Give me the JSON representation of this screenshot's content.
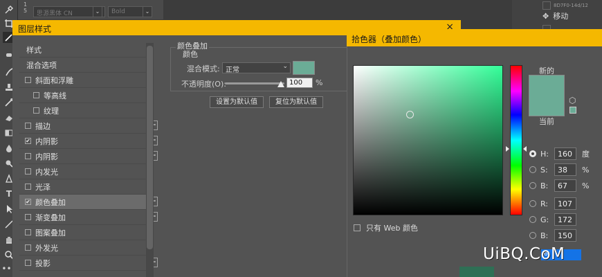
{
  "options_bar": {
    "digits": "1 5",
    "font_family": "思源黑体 CN",
    "font_style": "Bold"
  },
  "right_panel": {
    "item_label": "移动",
    "item_small": "8D7F0-14d/12"
  },
  "layer_style": {
    "title": "图层样式",
    "close": "×",
    "list": [
      {
        "label": "样式",
        "checkbox": false,
        "checked": false,
        "plus": false,
        "indent": false,
        "active": false
      },
      {
        "label": "混合选项",
        "checkbox": false,
        "checked": false,
        "plus": false,
        "indent": false,
        "active": false
      },
      {
        "label": "斜面和浮雕",
        "checkbox": true,
        "checked": false,
        "plus": false,
        "indent": false,
        "active": false
      },
      {
        "label": "等高线",
        "checkbox": true,
        "checked": false,
        "plus": false,
        "indent": true,
        "active": false
      },
      {
        "label": "纹理",
        "checkbox": true,
        "checked": false,
        "plus": false,
        "indent": true,
        "active": false
      },
      {
        "label": "描边",
        "checkbox": true,
        "checked": false,
        "plus": true,
        "indent": false,
        "active": false
      },
      {
        "label": "内阴影",
        "checkbox": true,
        "checked": true,
        "plus": true,
        "indent": false,
        "active": false
      },
      {
        "label": "内阴影",
        "checkbox": true,
        "checked": false,
        "plus": true,
        "indent": false,
        "active": false
      },
      {
        "label": "内发光",
        "checkbox": true,
        "checked": false,
        "plus": false,
        "indent": false,
        "active": false
      },
      {
        "label": "光泽",
        "checkbox": true,
        "checked": false,
        "plus": false,
        "indent": false,
        "active": false
      },
      {
        "label": "颜色叠加",
        "checkbox": true,
        "checked": true,
        "plus": true,
        "indent": false,
        "active": true
      },
      {
        "label": "渐变叠加",
        "checkbox": true,
        "checked": false,
        "plus": true,
        "indent": false,
        "active": false
      },
      {
        "label": "图案叠加",
        "checkbox": true,
        "checked": false,
        "plus": false,
        "indent": false,
        "active": false
      },
      {
        "label": "外发光",
        "checkbox": true,
        "checked": false,
        "plus": false,
        "indent": false,
        "active": false
      },
      {
        "label": "投影",
        "checkbox": true,
        "checked": false,
        "plus": true,
        "indent": false,
        "active": false
      }
    ],
    "color_overlay": {
      "legend": "颜色叠加",
      "sub_legend": "颜色",
      "blend_mode_label": "混合模式:",
      "blend_mode": "正常",
      "opacity_label": "不透明度(O):",
      "opacity": "100",
      "opacity_fraction": 1.0,
      "opacity_unit": "%",
      "swatch_color": "#6bac96",
      "set_default": "设置为默认值",
      "reset_default": "复位为默认值"
    }
  },
  "color_picker": {
    "title": "拾色器（叠加颜色）",
    "new_label": "新的",
    "current_label": "当前",
    "new_color": "#6bac96",
    "current_color": "#6bac96",
    "hsb": {
      "h": {
        "key": "H:",
        "value": "160",
        "unit": "度",
        "selected": true
      },
      "s": {
        "key": "S:",
        "value": "38",
        "unit": "%",
        "selected": false
      },
      "b": {
        "key": "B:",
        "value": "67",
        "unit": "%",
        "selected": false
      }
    },
    "rgb": {
      "r": {
        "key": "R:",
        "value": "107",
        "selected": false
      },
      "g": {
        "key": "G:",
        "value": "172",
        "selected": false
      },
      "b": {
        "key": "B:",
        "value": "150",
        "selected": false
      }
    },
    "web_only_label": "只有 Web 颜色",
    "hex_partial": "6"
  },
  "watermark": {
    "text": "UiBQ.CoM"
  }
}
